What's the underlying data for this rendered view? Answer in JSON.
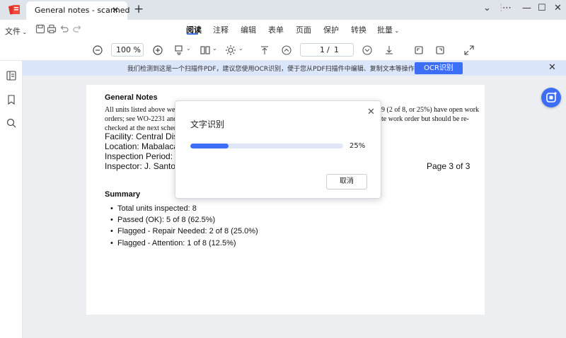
{
  "titlebar": {
    "tab_title": "General notes - scanned",
    "tab_close": "✕",
    "tab_add": "+",
    "controls": [
      "⌄",
      "⋮",
      "⋯",
      "—",
      "☐",
      "✕"
    ]
  },
  "menubar": {
    "file_label": "文件",
    "tabs": [
      {
        "label": "阅读",
        "active": true
      },
      {
        "label": "注释"
      },
      {
        "label": "编辑"
      },
      {
        "label": "表单"
      },
      {
        "label": "页面"
      },
      {
        "label": "保护"
      },
      {
        "label": "转换"
      },
      {
        "label": "批量"
      }
    ]
  },
  "toolbar": {
    "zoom": "100 %",
    "page_current": "1",
    "page_sep": "/",
    "page_total": "1"
  },
  "banner": {
    "text": "我们检测到这是一个扫描件PDF，建议您使用OCR识别，便于您从PDF扫描件中编辑、复制文本等操作。",
    "button": "OCR识别",
    "close": "✕"
  },
  "document": {
    "heading_notes": "General Notes",
    "notes_line1_start": "All units listed above were",
    "notes_line1_end": "9 (2 of 8, or 25%) have open work",
    "notes_line2_start": "orders; see WO-2231 and",
    "notes_line2_end": "te work order but should be re-",
    "notes_line3": "checked at the next sched",
    "facility": "Facility: Central Distr",
    "location": "Location: Mabalacat",
    "period": "Inspection Period: 01",
    "inspector": "Inspector: J. Santos,",
    "page_label": "Page 3 of 3",
    "summary_heading": "Summary",
    "summary_items": [
      "Total units inspected: 8",
      "Passed (OK): 5 of 8 (62.5%)",
      "Flagged - Repair Needed: 2 of 8 (25.0%)",
      "Flagged - Attention: 1 of 8 (12.5%)"
    ]
  },
  "dialog": {
    "title": "文字识别",
    "progress": 0.25,
    "progress_label": "25%",
    "cancel": "取消",
    "close": "✕"
  },
  "colors": {
    "accent": "#3d6ef6",
    "banner_bg": "#dbe6fb",
    "progress_track": "#dfe7f7"
  }
}
